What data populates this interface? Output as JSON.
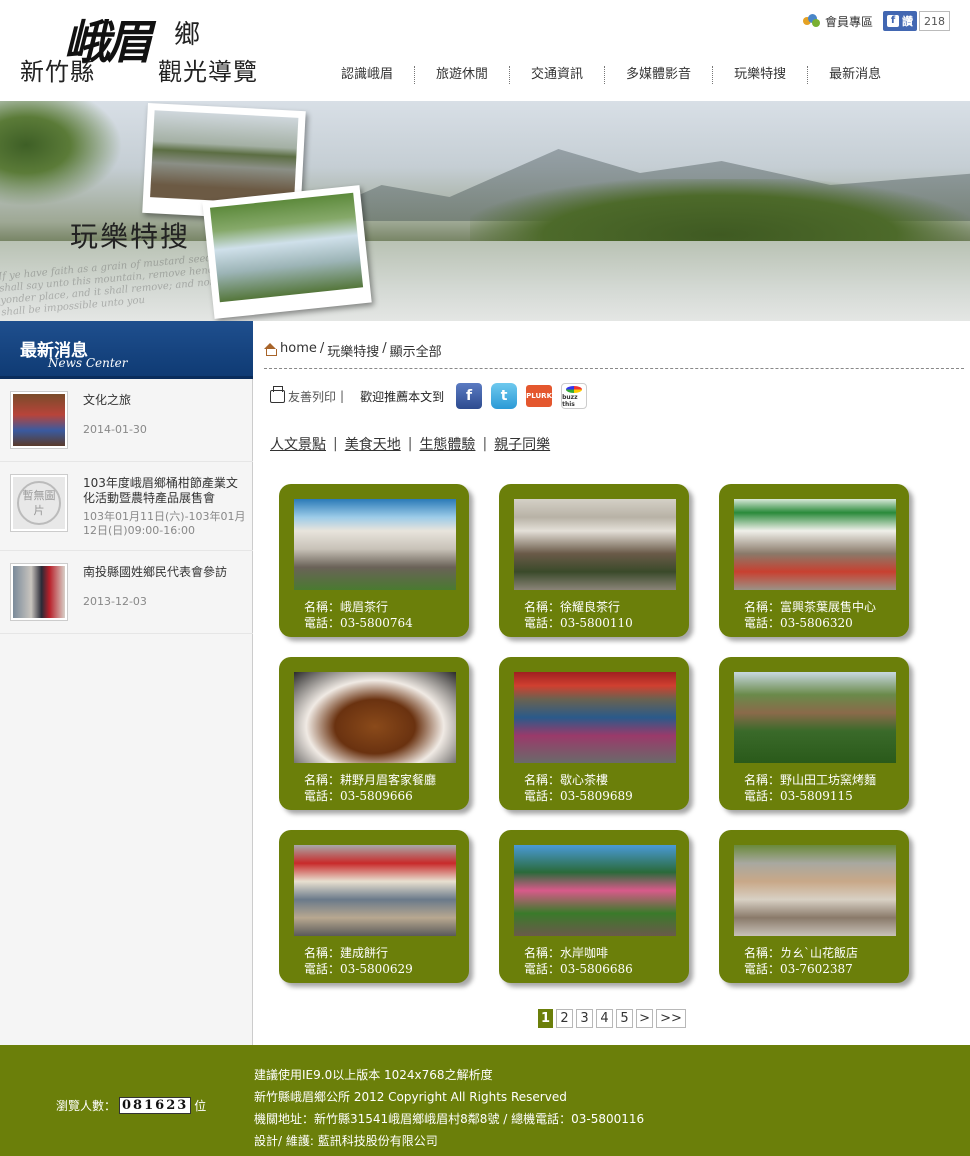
{
  "site": {
    "logo_prefix": "新竹縣",
    "logo_script": "峨眉",
    "logo_top": "鄉",
    "logo_suffix": "觀光導覽"
  },
  "topbar": {
    "member_label": "會員專區",
    "fb_like_label": "讚",
    "fb_like_count": "218"
  },
  "nav": {
    "items": [
      "認識峨眉",
      "旅遊休閒",
      "交通資訊",
      "多媒體影音",
      "玩樂特搜",
      "最新消息"
    ]
  },
  "banner": {
    "title": "玩樂特搜",
    "script_text": "If ye have faith as a grain of mustard seed, ye shall say unto this mountain, remove hence to yonder place, and it shall remove; and nothing shall be impossible unto you"
  },
  "sidebar": {
    "title": "最新消息",
    "subtitle": "News Center",
    "news": [
      {
        "title": "文化之旅",
        "date": "2014-01-30",
        "thumb": "photo"
      },
      {
        "title": "103年度峨眉鄉桶柑節產業文化活動暨農特產品展售會",
        "date": "103年01月11日(六)-103年01月12日(日)09:00-16:00",
        "thumb": "placeholder",
        "placeholder_text": "暫無圖片"
      },
      {
        "title": "南投縣國姓鄉民代表會參訪",
        "date": "2013-12-03",
        "thumb": "photo"
      }
    ]
  },
  "breadcrumb": {
    "home": "home",
    "section": "玩樂特搜",
    "current": "顯示全部"
  },
  "share": {
    "print_label": "友善列印",
    "recommend_label": "歡迎推薦本文到",
    "services": [
      "facebook-icon",
      "twitter-icon",
      "plurk-icon",
      "buzz-icon"
    ],
    "plurk_label": "PLURK",
    "buzz_label": "buzz this"
  },
  "tabs": [
    "人文景點",
    "美食天地",
    "生態體驗",
    "親子同樂"
  ],
  "listings": [
    {
      "name": "名稱：峨眉茶行",
      "tel": "電話：03-5800764"
    },
    {
      "name": "名稱：徐耀良茶行",
      "tel": "電話：03-5800110"
    },
    {
      "name": "名稱：富興茶葉展售中心",
      "tel": "電話：03-5806320"
    },
    {
      "name": "名稱：耕野月眉客家餐廳",
      "tel": "電話：03-5809666"
    },
    {
      "name": "名稱：歇心茶樓",
      "tel": "電話：03-5809689"
    },
    {
      "name": "名稱：野山田工坊窯烤麵",
      "tel": "電話：03-5809115"
    },
    {
      "name": "名稱：建成餅行",
      "tel": "電話：03-5800629"
    },
    {
      "name": "名稱：水岸咖啡",
      "tel": "電話：03-5806686"
    },
    {
      "name": "名稱：ㄌㄠˋ山花飯店",
      "tel": "電話：03-7602387"
    }
  ],
  "pagination": {
    "pages": [
      "1",
      "2",
      "3",
      "4",
      "5"
    ],
    "current": "1",
    "next": ">",
    "last": ">>"
  },
  "footer": {
    "counter_label": "瀏覽人數：",
    "counter_value": "081623",
    "counter_unit": "位",
    "lines": [
      "建議使用IE9.0以上版本 1024x768之解析度",
      "新竹縣峨眉鄉公所 2012 Copyright All Rights Reserved",
      "機關地址：新竹縣31541峨眉鄉峨眉村8鄰8號 / 總機電話：03-5800116",
      "設計/ 維護: 藍訊科技股份有限公司"
    ]
  },
  "colors": {
    "brand_green": "#6b7f0a",
    "news_blue": "#1f4f8e"
  }
}
